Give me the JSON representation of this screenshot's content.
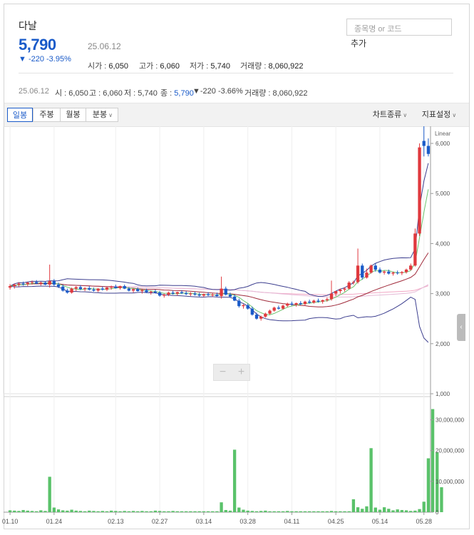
{
  "stock": {
    "name": "다날",
    "price": "5,790",
    "date": "25.06.12",
    "change": "▼ -220 -3.95%",
    "stats": [
      {
        "label": "시가 : ",
        "value": "6,050"
      },
      {
        "label": "고가 : ",
        "value": "6,060"
      },
      {
        "label": "저가 : ",
        "value": "5,740"
      },
      {
        "label": "거래량 : ",
        "value": "8,060,922"
      }
    ]
  },
  "search": {
    "placeholder": "종목명 or 코드",
    "add_label": "추가"
  },
  "ohlc_row": {
    "date": "25.06.12",
    "open_label": "시 : ",
    "open": "6,050",
    "high_label": "고 : ",
    "high": "6,060",
    "low_label": "저 : ",
    "low": "5,740",
    "close_label": "종 : ",
    "close": "5,790",
    "change": "▼-220 -3.66%",
    "volume_label": "거래량 : ",
    "volume": "8,060,922"
  },
  "toolbar": {
    "periods": [
      "일봉",
      "주봉",
      "월봉",
      "분봉"
    ],
    "active_period": "일봉",
    "chart_type_label": "차트종류",
    "indicator_label": "지표설정"
  },
  "colors": {
    "up": "#e0393e",
    "down": "#1a5bc9",
    "volume": "#5ac26a",
    "accent": "#1a5bc9"
  },
  "chart_data": {
    "type": "candlestick",
    "scale_label": "Linear",
    "price_ticks": [
      "6,000",
      "5,000",
      "4,000",
      "3,000",
      "2,000",
      "1,000"
    ],
    "volume_ticks": [
      "30,000,000",
      "20,000,000",
      "10,000,000",
      "0"
    ],
    "x_ticks": [
      "01.10",
      "01.24",
      "02.13",
      "02.27",
      "03.14",
      "03.28",
      "04.11",
      "04.25",
      "05.14",
      "05.28"
    ],
    "x_tick_index": [
      0,
      10,
      24,
      34,
      44,
      54,
      64,
      74,
      84,
      94
    ],
    "ylim": [
      1000,
      6200
    ],
    "volume_ylim": [
      0,
      35000000
    ],
    "candles": [
      [
        3120,
        3190,
        3080,
        3150
      ],
      [
        3150,
        3200,
        3100,
        3180
      ],
      [
        3180,
        3230,
        3140,
        3200
      ],
      [
        3200,
        3240,
        3160,
        3190
      ],
      [
        3190,
        3230,
        3150,
        3220
      ],
      [
        3220,
        3260,
        3180,
        3230
      ],
      [
        3230,
        3270,
        3190,
        3200
      ],
      [
        3200,
        3240,
        3160,
        3220
      ],
      [
        3220,
        3250,
        3170,
        3180
      ],
      [
        3180,
        3580,
        3120,
        3250
      ],
      [
        3250,
        3290,
        3150,
        3180
      ],
      [
        3180,
        3220,
        3110,
        3140
      ],
      [
        3140,
        3180,
        3040,
        3060
      ],
      [
        3060,
        3100,
        3000,
        3020
      ],
      [
        3020,
        3120,
        3000,
        3100
      ],
      [
        3100,
        3150,
        3050,
        3130
      ],
      [
        3130,
        3170,
        3070,
        3090
      ],
      [
        3090,
        3130,
        3050,
        3110
      ],
      [
        3110,
        3150,
        3060,
        3080
      ],
      [
        3080,
        3120,
        3040,
        3060
      ],
      [
        3060,
        3110,
        3030,
        3100
      ],
      [
        3100,
        3140,
        3060,
        3080
      ],
      [
        3080,
        3130,
        3050,
        3120
      ],
      [
        3120,
        3160,
        3080,
        3140
      ],
      [
        3140,
        3180,
        3100,
        3110
      ],
      [
        3110,
        3160,
        3080,
        3150
      ],
      [
        3150,
        3180,
        3090,
        3100
      ],
      [
        3100,
        3130,
        3040,
        3060
      ],
      [
        3060,
        3100,
        3020,
        3090
      ],
      [
        3090,
        3120,
        3040,
        3050
      ],
      [
        3050,
        3090,
        3000,
        3070
      ],
      [
        3070,
        3100,
        3010,
        3030
      ],
      [
        3030,
        3060,
        2980,
        3040
      ],
      [
        3040,
        3080,
        3000,
        3020
      ],
      [
        3020,
        3050,
        2940,
        2960
      ],
      [
        2960,
        3000,
        2920,
        2980
      ],
      [
        2980,
        3040,
        2950,
        3020
      ],
      [
        3020,
        3060,
        2980,
        3000
      ],
      [
        3000,
        3040,
        2960,
        3030
      ],
      [
        3030,
        3070,
        2990,
        3010
      ],
      [
        3010,
        3050,
        2970,
        2990
      ],
      [
        2990,
        3030,
        2950,
        3000
      ],
      [
        3000,
        3040,
        2960,
        2980
      ],
      [
        2980,
        3020,
        2940,
        2960
      ],
      [
        2960,
        3000,
        2930,
        2990
      ],
      [
        2990,
        3030,
        2950,
        2970
      ],
      [
        2970,
        3010,
        2930,
        2980
      ],
      [
        2980,
        3020,
        2940,
        2950
      ],
      [
        2950,
        3340,
        2900,
        3100
      ],
      [
        3100,
        3140,
        2960,
        2980
      ],
      [
        2980,
        3020,
        2920,
        2940
      ],
      [
        2940,
        2980,
        2850,
        2860
      ],
      [
        2860,
        2900,
        2720,
        2750
      ],
      [
        2750,
        2790,
        2700,
        2770
      ],
      [
        2770,
        2800,
        2680,
        2700
      ],
      [
        2700,
        2740,
        2560,
        2580
      ],
      [
        2580,
        2620,
        2480,
        2500
      ],
      [
        2500,
        2560,
        2460,
        2540
      ],
      [
        2540,
        2620,
        2520,
        2600
      ],
      [
        2600,
        2680,
        2580,
        2660
      ],
      [
        2660,
        2740,
        2640,
        2720
      ],
      [
        2720,
        2760,
        2680,
        2700
      ],
      [
        2700,
        2780,
        2680,
        2760
      ],
      [
        2760,
        2820,
        2730,
        2800
      ],
      [
        2800,
        2840,
        2760,
        2780
      ],
      [
        2780,
        2820,
        2740,
        2810
      ],
      [
        2810,
        2850,
        2770,
        2790
      ],
      [
        2790,
        2860,
        2770,
        2840
      ],
      [
        2840,
        2880,
        2800,
        2820
      ],
      [
        2820,
        2880,
        2800,
        2860
      ],
      [
        2860,
        2900,
        2820,
        2840
      ],
      [
        2840,
        2880,
        2800,
        2870
      ],
      [
        2870,
        2920,
        2840,
        2890
      ],
      [
        2890,
        3260,
        2860,
        3000
      ],
      [
        3000,
        3040,
        2950,
        3050
      ],
      [
        3050,
        3100,
        3000,
        3080
      ],
      [
        3080,
        3130,
        3040,
        3100
      ],
      [
        3100,
        3250,
        3080,
        3220
      ],
      [
        3220,
        3260,
        3180,
        3230
      ],
      [
        3230,
        3900,
        3200,
        3560
      ],
      [
        3560,
        3600,
        3280,
        3320
      ],
      [
        3320,
        3500,
        3300,
        3420
      ],
      [
        3420,
        3580,
        3400,
        3560
      ],
      [
        3560,
        3600,
        3440,
        3480
      ],
      [
        3480,
        3520,
        3400,
        3420
      ],
      [
        3420,
        3460,
        3380,
        3440
      ],
      [
        3440,
        3480,
        3380,
        3400
      ],
      [
        3400,
        3440,
        3360,
        3420
      ],
      [
        3420,
        3460,
        3380,
        3410
      ],
      [
        3410,
        3450,
        3370,
        3430
      ],
      [
        3430,
        3500,
        3400,
        3480
      ],
      [
        3480,
        3600,
        3460,
        3560
      ],
      [
        3560,
        4300,
        3540,
        4200
      ],
      [
        4200,
        6000,
        4150,
        5920
      ],
      [
        6050,
        6400,
        5740,
        5950
      ],
      [
        5950,
        6100,
        5740,
        5790
      ]
    ],
    "volume": [
      600000,
      500000,
      400000,
      700000,
      500000,
      400000,
      300000,
      600000,
      400000,
      11500000,
      1500000,
      900000,
      600000,
      500000,
      800000,
      500000,
      400000,
      300000,
      500000,
      400000,
      300000,
      400000,
      300000,
      500000,
      400000,
      300000,
      400000,
      300000,
      400000,
      300000,
      400000,
      300000,
      300000,
      500000,
      400000,
      300000,
      300000,
      400000,
      300000,
      300000,
      300000,
      300000,
      300000,
      300000,
      300000,
      300000,
      300000,
      300000,
      3200000,
      700000,
      500000,
      20300000,
      1500000,
      800000,
      500000,
      400000,
      300000,
      400000,
      500000,
      300000,
      300000,
      300000,
      300000,
      400000,
      300000,
      300000,
      300000,
      300000,
      300000,
      300000,
      300000,
      300000,
      300000,
      400000,
      300000,
      300000,
      300000,
      300000,
      4200000,
      1600000,
      1100000,
      1900000,
      20800000,
      1500000,
      800000,
      1600000,
      1100000,
      600000,
      900000,
      700000,
      600000,
      400000,
      500000,
      1000000,
      3400000,
      17500000,
      33500000,
      19500000,
      8100000
    ]
  }
}
